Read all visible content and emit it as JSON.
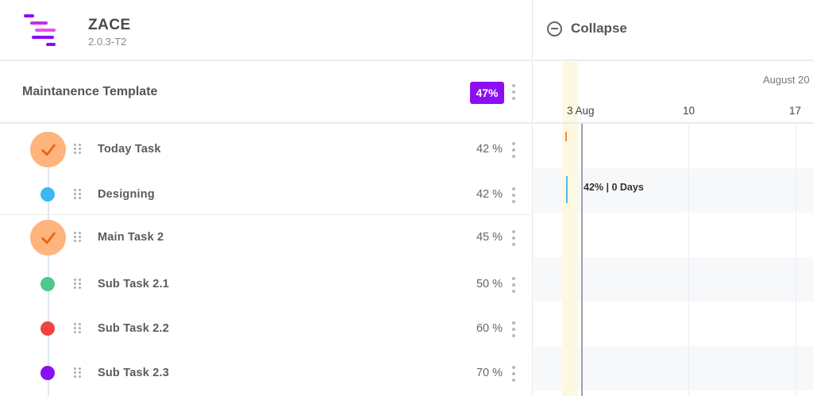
{
  "app": {
    "name": "ZACE",
    "version": "2.0.3-T2"
  },
  "template": {
    "name": "Maintanence Template",
    "progress": "47%",
    "badge_color": "#8c0ef5"
  },
  "tasks": [
    {
      "name": "Today Task",
      "progress": "42 %",
      "status": "completed",
      "color": "#ffb47e"
    },
    {
      "name": "Designing",
      "progress": "42 %",
      "status": "dot",
      "color": "#3ab8f5"
    },
    {
      "name": "Main Task 2",
      "progress": "45 %",
      "status": "completed",
      "color": "#ffb47e"
    },
    {
      "name": "Sub Task 2.1",
      "progress": "50 %",
      "status": "dot",
      "color": "#4cc98a"
    },
    {
      "name": "Sub Task 2.2",
      "progress": "60 %",
      "status": "dot",
      "color": "#f24343"
    },
    {
      "name": "Sub Task 2.3",
      "progress": "70 %",
      "status": "dot",
      "color": "#8c0ef5"
    }
  ],
  "gantt": {
    "collapse_label": "Collapse",
    "month": "August 20",
    "days": [
      "3 Aug",
      "10",
      "17"
    ],
    "bar_label": "42% | 0 Days"
  },
  "icons": {
    "logo": "zace-logo-icon",
    "status_complete": "check-icon",
    "drag": "drag-handle-icon",
    "menu": "kebab-menu-icon",
    "collapse": "minus-circle-icon"
  }
}
